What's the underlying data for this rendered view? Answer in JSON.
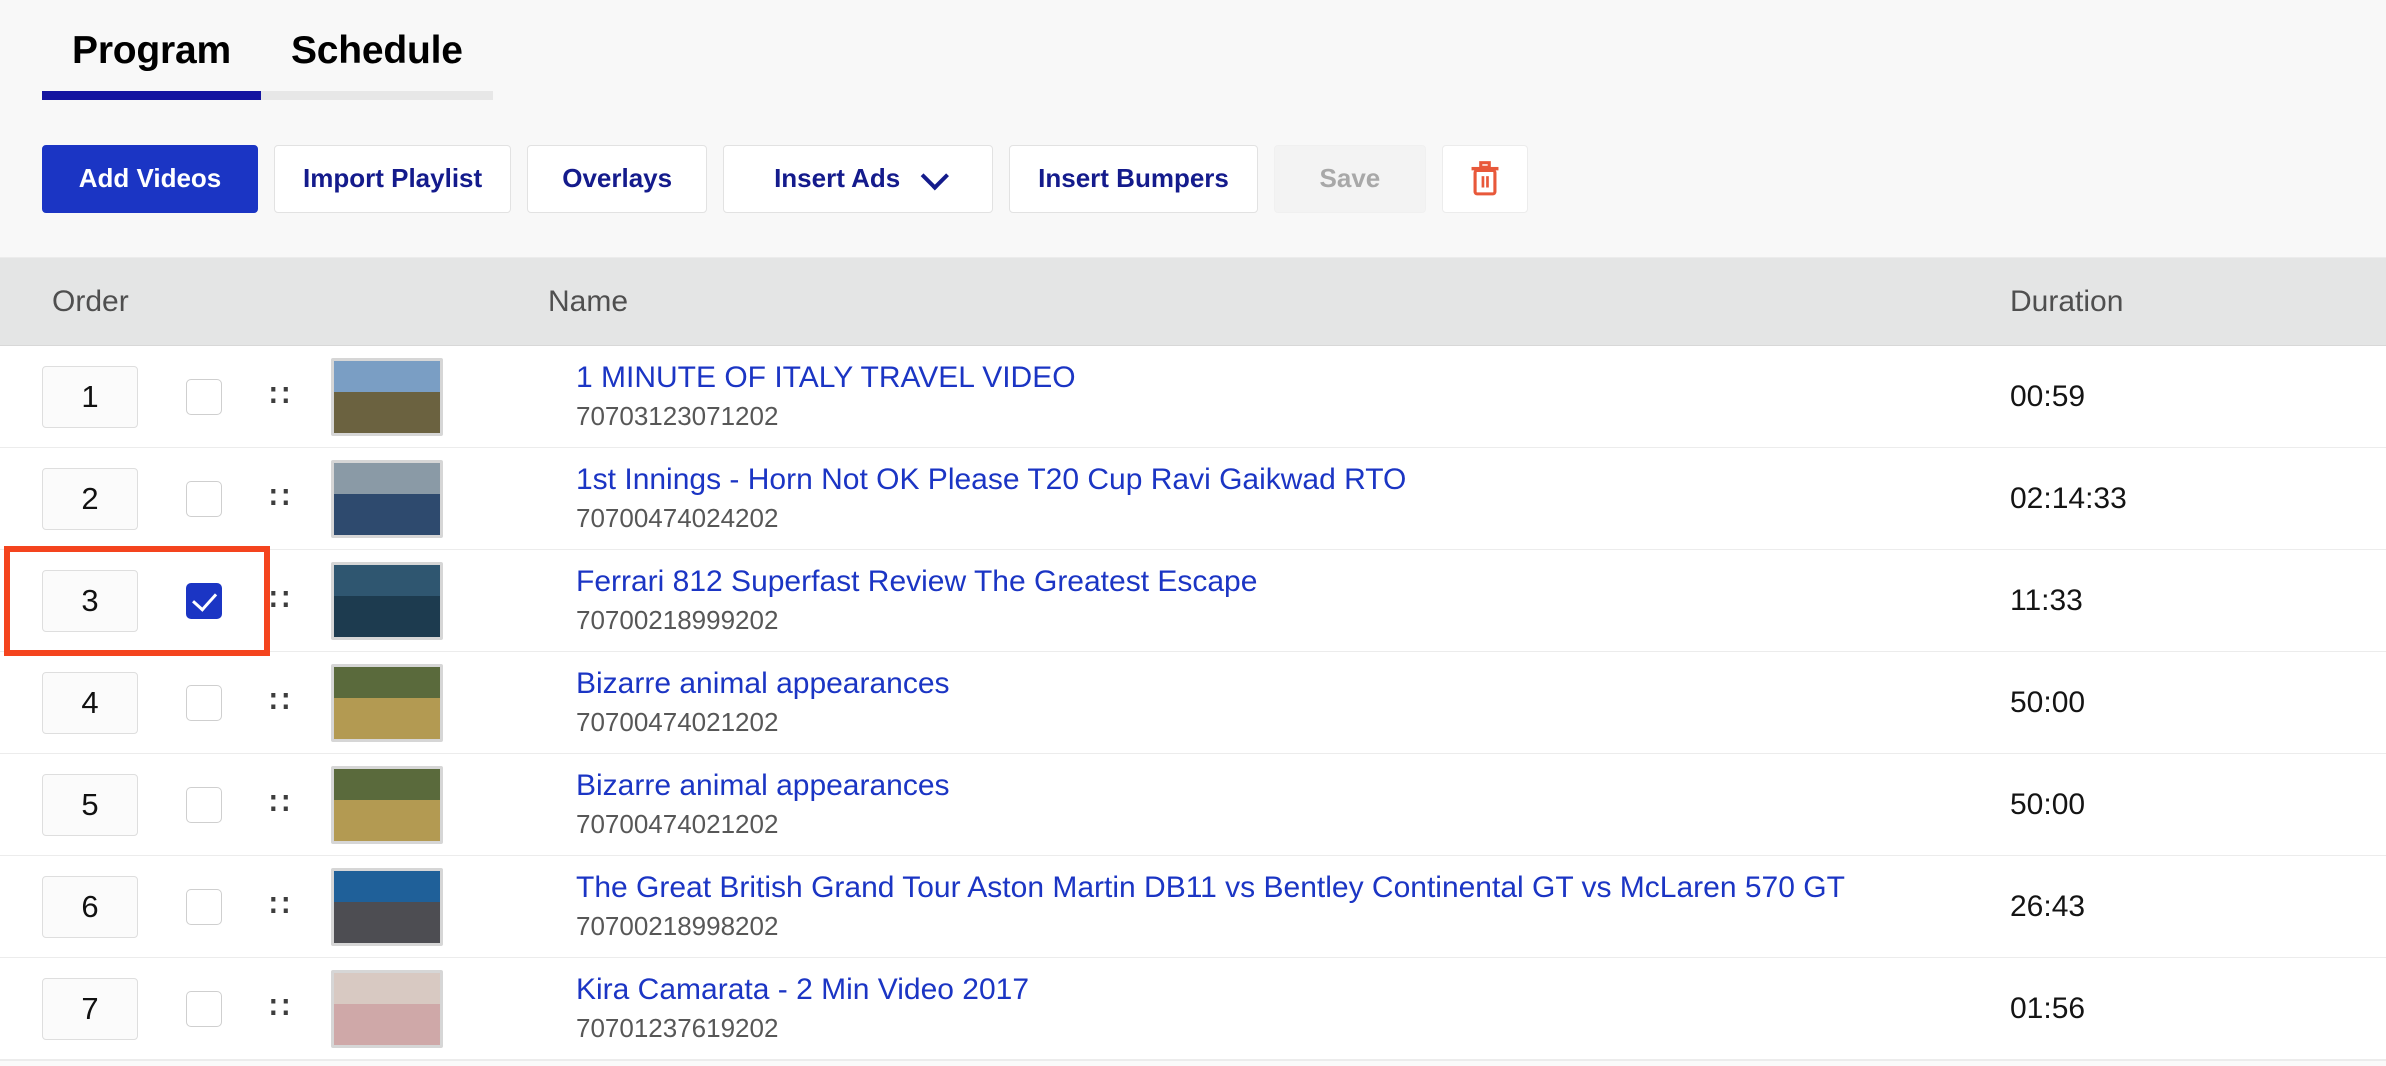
{
  "tabs": [
    {
      "label": "Program",
      "active": true
    },
    {
      "label": "Schedule",
      "active": false
    }
  ],
  "toolbar": {
    "add_videos": "Add Videos",
    "import_playlist": "Import Playlist",
    "overlays": "Overlays",
    "insert_ads": "Insert Ads",
    "insert_bumpers": "Insert Bumpers",
    "save": "Save",
    "delete_icon": "trash-icon",
    "chevron_icon": "chevron-down-icon",
    "colors": {
      "primary": "#1b35c4",
      "secondary_text": "#141b8c",
      "disabled_text": "#a8a8a8",
      "delete_icon": "#e8583a"
    }
  },
  "table": {
    "columns": [
      "Order",
      "Name",
      "Duration"
    ],
    "rows": [
      {
        "order": "1",
        "checked": false,
        "title": "1 MINUTE OF ITALY TRAVEL VIDEO",
        "id": "70703123071202",
        "duration": "00:59",
        "thumb_sky": "#7a9ec4",
        "thumb_gnd": "#6b6240"
      },
      {
        "order": "2",
        "checked": false,
        "title": "1st Innings - Horn Not OK Please T20 Cup Ravi Gaikwad RTO",
        "id": "70700474024202",
        "duration": "02:14:33",
        "thumb_sky": "#8a9aa6",
        "thumb_gnd": "#2e4a6e"
      },
      {
        "order": "3",
        "checked": true,
        "title": "Ferrari 812 Superfast Review The Greatest Escape",
        "id": "70700218999202",
        "duration": "11:33",
        "thumb_sky": "#2f5670",
        "thumb_gnd": "#1d3b4f",
        "highlighted": true
      },
      {
        "order": "4",
        "checked": false,
        "title": "Bizarre animal appearances",
        "id": "70700474021202",
        "duration": "50:00",
        "thumb_sky": "#5a6a3c",
        "thumb_gnd": "#b39a52"
      },
      {
        "order": "5",
        "checked": false,
        "title": "Bizarre animal appearances",
        "id": "70700474021202",
        "duration": "50:00",
        "thumb_sky": "#5a6a3c",
        "thumb_gnd": "#b39a52"
      },
      {
        "order": "6",
        "checked": false,
        "title": "The Great British Grand Tour Aston Martin DB11 vs Bentley Continental GT vs McLaren 570 GT",
        "id": "70700218998202",
        "duration": "26:43",
        "thumb_sky": "#1f6099",
        "thumb_gnd": "#4d4d52"
      },
      {
        "order": "7",
        "checked": false,
        "title": "Kira Camarata - 2 Min Video 2017",
        "id": "70701237619202",
        "duration": "01:56",
        "thumb_sky": "#d8c9c2",
        "thumb_gnd": "#cfa8a8"
      }
    ]
  },
  "annotation": {
    "highlight_color": "#f4441e",
    "target_row_index": 2
  }
}
